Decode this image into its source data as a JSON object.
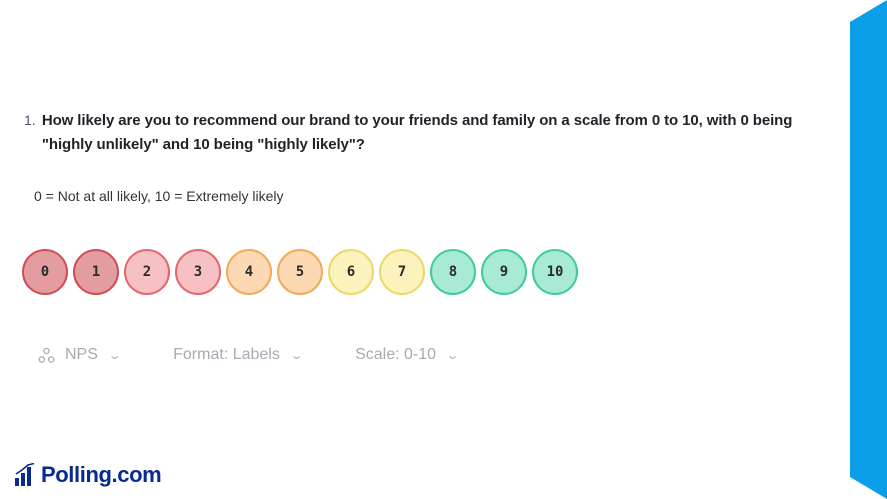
{
  "question": {
    "number": "1.",
    "text": "How likely are you to recommend our brand to your friends and family on a scale from 0 to 10, with 0 being \"highly unlikely\" and 10 being \"highly likely\"?"
  },
  "scale_hint": "0 = Not at all likely, 10 = Extremely likely",
  "scale": [
    {
      "label": "0",
      "fill": "#e39da0",
      "border": "#cd4f55"
    },
    {
      "label": "1",
      "fill": "#e39da0",
      "border": "#cd4f55"
    },
    {
      "label": "2",
      "fill": "#f7c0c2",
      "border": "#e2676d"
    },
    {
      "label": "3",
      "fill": "#f7c0c2",
      "border": "#e2676d"
    },
    {
      "label": "4",
      "fill": "#fcd8b3",
      "border": "#f0a95a"
    },
    {
      "label": "5",
      "fill": "#fcd8b3",
      "border": "#f0a95a"
    },
    {
      "label": "6",
      "fill": "#fcf2bc",
      "border": "#ead96a"
    },
    {
      "label": "7",
      "fill": "#fcf2bc",
      "border": "#ead96a"
    },
    {
      "label": "8",
      "fill": "#a8ead5",
      "border": "#3fcc95"
    },
    {
      "label": "9",
      "fill": "#a8ead5",
      "border": "#3fcc95"
    },
    {
      "label": "10",
      "fill": "#a8ead5",
      "border": "#3fcc95"
    }
  ],
  "options": {
    "nps": {
      "label": "NPS",
      "icon": "people-group-icon"
    },
    "format": {
      "label": "Format: Labels"
    },
    "scale": {
      "label": "Scale: 0-10"
    }
  },
  "brand": {
    "name": "Polling.com",
    "color": "#0a2a8f",
    "accent": "#0a9fe8"
  }
}
